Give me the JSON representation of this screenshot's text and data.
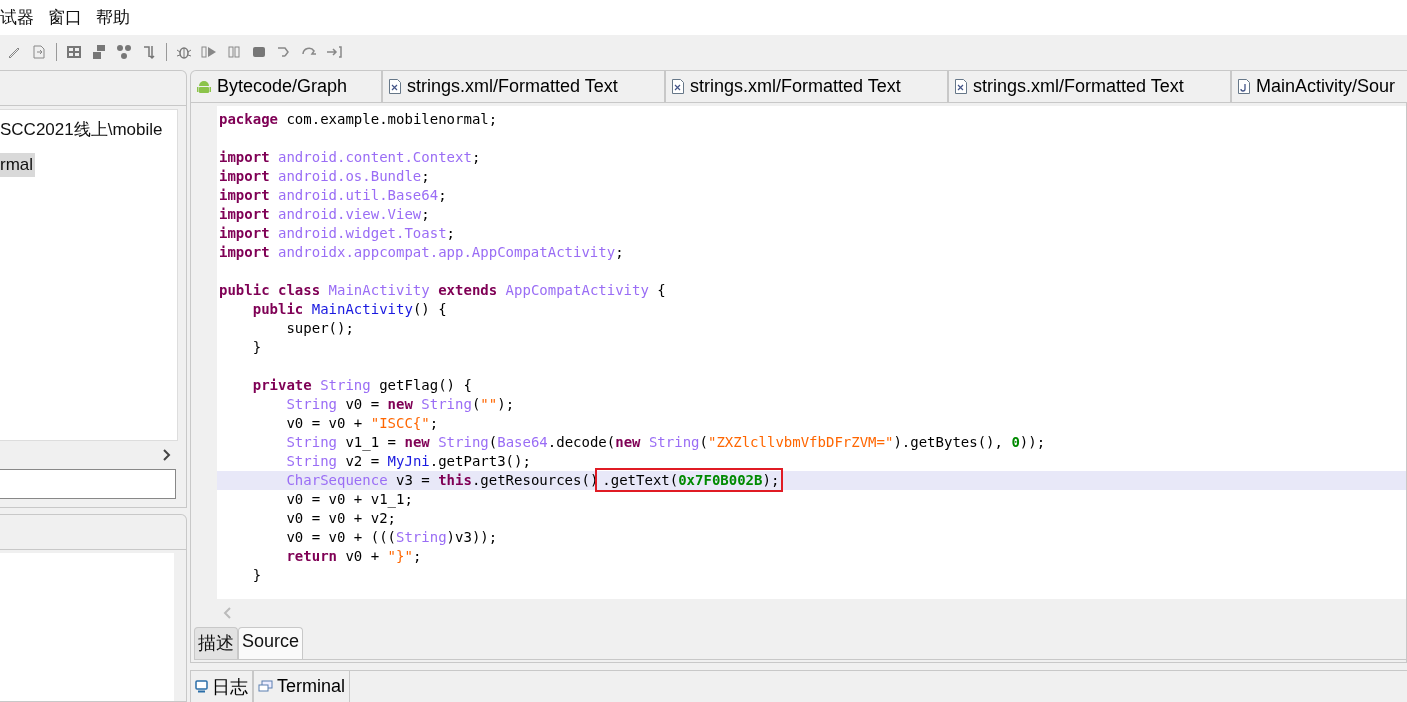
{
  "menu": [
    "试器",
    "窗口",
    "帮助"
  ],
  "left_panel": {
    "tree_items": [
      {
        "label": "SCC2021线上\\mobile",
        "selected": false
      },
      {
        "label": "rmal",
        "selected": true
      }
    ]
  },
  "editor_tabs": [
    {
      "kind": "android",
      "label": "Bytecode/Graph"
    },
    {
      "kind": "xml",
      "label": "strings.xml/Formatted Text"
    },
    {
      "kind": "xml",
      "label": "strings.xml/Formatted Text"
    },
    {
      "kind": "xml",
      "label": "strings.xml/Formatted Text"
    },
    {
      "kind": "java",
      "label": "MainActivity/Sour"
    }
  ],
  "code": {
    "lines": [
      {
        "selected": false,
        "tokens": [
          {
            "kw": "package"
          },
          {
            "plain": " com.example.mobilenormal;"
          }
        ]
      },
      {
        "selected": false
      },
      {
        "selected": false,
        "tokens": [
          {
            "kw": "import"
          },
          {
            "type": " android.content.Context"
          },
          {
            "plain": ";"
          }
        ]
      },
      {
        "selected": false,
        "tokens": [
          {
            "kw": "import"
          },
          {
            "type": " android.os.Bundle"
          },
          {
            "plain": ";"
          }
        ]
      },
      {
        "selected": false,
        "tokens": [
          {
            "kw": "import"
          },
          {
            "type": " android.util.Base64"
          },
          {
            "plain": ";"
          }
        ]
      },
      {
        "selected": false,
        "tokens": [
          {
            "kw": "import"
          },
          {
            "type": " android.view.View"
          },
          {
            "plain": ";"
          }
        ]
      },
      {
        "selected": false,
        "tokens": [
          {
            "kw": "import"
          },
          {
            "type": " android.widget.Toast"
          },
          {
            "plain": ";"
          }
        ]
      },
      {
        "selected": false,
        "tokens": [
          {
            "kw": "import"
          },
          {
            "type": " androidx.appcompat.app.AppCompatActivity"
          },
          {
            "plain": ";"
          }
        ]
      },
      {
        "selected": false
      },
      {
        "selected": false,
        "tokens": [
          {
            "kw": "public class"
          },
          {
            "type": " MainActivity"
          },
          {
            "kw": " extends"
          },
          {
            "type": " AppCompatActivity"
          },
          {
            "plain": " {"
          }
        ]
      },
      {
        "selected": false,
        "tokens": [
          {
            "kw": "    public"
          },
          {
            "ident": " MainActivity"
          },
          {
            "plain": "() {"
          }
        ]
      },
      {
        "selected": false,
        "tokens": [
          {
            "plain": "        super();"
          }
        ]
      },
      {
        "selected": false,
        "tokens": [
          {
            "plain": "    }"
          }
        ]
      },
      {
        "selected": false
      },
      {
        "selected": false,
        "tokens": [
          {
            "kw": "    private"
          },
          {
            "type": " String"
          },
          {
            "plain": " getFlag() {"
          }
        ]
      },
      {
        "selected": false,
        "tokens": [
          {
            "type": "        String"
          },
          {
            "plain": " v0 ="
          },
          {
            "kw": " new"
          },
          {
            "type": " String"
          },
          {
            "plain": "("
          },
          {
            "str": "\"\""
          },
          {
            "plain": ");"
          }
        ]
      },
      {
        "selected": false,
        "tokens": [
          {
            "plain": "        v0 = v0 +"
          },
          {
            "str": " \"ISCC{\""
          },
          {
            "plain": ";"
          }
        ]
      },
      {
        "selected": false,
        "tokens": [
          {
            "type": "        String"
          },
          {
            "plain": " v1_1 ="
          },
          {
            "kw": " new"
          },
          {
            "type": " String"
          },
          {
            "plain": "("
          },
          {
            "type": "Base64"
          },
          {
            "plain": ".decode("
          },
          {
            "kw": "new"
          },
          {
            "type": " String"
          },
          {
            "plain": "("
          },
          {
            "str": "\"ZXZlcllvbmVfbDFrZVM=\""
          },
          {
            "plain": ").getBytes(),"
          },
          {
            "num": " 0"
          },
          {
            "plain": "));"
          }
        ]
      },
      {
        "selected": false,
        "tokens": [
          {
            "type": "        String"
          },
          {
            "plain": " v2 ="
          },
          {
            "ident": " MyJni"
          },
          {
            "plain": ".getPart3();"
          }
        ]
      },
      {
        "selected": true,
        "tokens": [
          {
            "type": "        CharSequence"
          },
          {
            "plain": " v3 ="
          },
          {
            "kw": " this"
          },
          {
            "plain": ".getResources()"
          }
        ],
        "boxed_tokens": [
          {
            "plain": ".getText("
          },
          {
            "num": "0x7F0B002B"
          },
          {
            "plain": ");"
          }
        ]
      },
      {
        "selected": false,
        "tokens": [
          {
            "plain": "        v0 = v0 + v1_1;"
          }
        ]
      },
      {
        "selected": false,
        "tokens": [
          {
            "plain": "        v0 = v0 + v2;"
          }
        ]
      },
      {
        "selected": false,
        "tokens": [
          {
            "plain": "        v0 = v0 + ((("
          },
          {
            "type": "String"
          },
          {
            "plain": ")v3));"
          }
        ]
      },
      {
        "selected": false,
        "tokens": [
          {
            "kw": "        return"
          },
          {
            "plain": " v0 +"
          },
          {
            "str": " \"}\""
          },
          {
            "plain": ";"
          }
        ]
      },
      {
        "selected": false,
        "tokens": [
          {
            "plain": "    }"
          }
        ]
      }
    ]
  },
  "editor_bottom_tabs": [
    {
      "label": "描述",
      "selected": false
    },
    {
      "label": "Source",
      "selected": true
    }
  ],
  "bottom_tabs": [
    {
      "kind": "log",
      "label": "日志"
    },
    {
      "kind": "terminal",
      "label": "Terminal"
    }
  ]
}
